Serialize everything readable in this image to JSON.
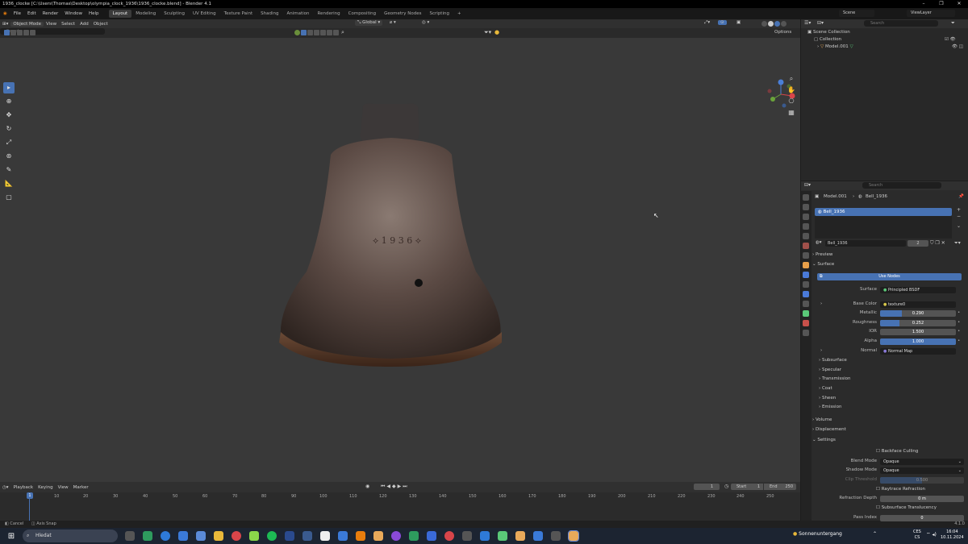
{
  "window": {
    "title": "1936_clocke [C:\\Users\\Thomas\\Desktop\\olympia_clock_1936\\1936_clocke.blend] - Blender 4.1"
  },
  "menu": [
    "File",
    "Edit",
    "Render",
    "Window",
    "Help"
  ],
  "workspaces": [
    "Layout",
    "Modeling",
    "Sculpting",
    "UV Editing",
    "Texture Paint",
    "Shading",
    "Animation",
    "Rendering",
    "Compositing",
    "Geometry Nodes",
    "Scripting"
  ],
  "topright": {
    "scene": "Scene",
    "viewlayer": "ViewLayer"
  },
  "viewport": {
    "mode": "Object Mode",
    "menus": [
      "View",
      "Select",
      "Add",
      "Object"
    ],
    "orientation": "Global",
    "search_placeholder": "Search",
    "options": "Options"
  },
  "outliner": {
    "scene_collection": "Scene Collection",
    "collection": "Collection",
    "object": "Model.001",
    "search_placeholder": "Search"
  },
  "properties": {
    "breadcrumb_object": "Model.001",
    "breadcrumb_material": "Bell_1936",
    "slot": "Bell_1936",
    "material_name": "Bell_1936",
    "user_count": "2",
    "preview": "Preview",
    "surface_section": "Surface",
    "use_nodes": "Use Nodes",
    "surface_label": "Surface",
    "surface_value": "Principled BSDF",
    "base_color_label": "Base Color",
    "base_color_value": "texture0",
    "metallic_label": "Metallic",
    "metallic": "0.290",
    "metallic_frac": 0.29,
    "roughness_label": "Roughness",
    "roughness": "0.252",
    "roughness_frac": 0.252,
    "ior_label": "IOR",
    "ior": "1.500",
    "alpha_label": "Alpha",
    "alpha": "1.000",
    "alpha_frac": 1.0,
    "normal_label": "Normal",
    "normal_value": "Normal Map",
    "subsections": [
      "Subsurface",
      "Specular",
      "Transmission",
      "Coat",
      "Sheen",
      "Emission"
    ],
    "volume": "Volume",
    "displacement": "Displacement",
    "settings": "Settings",
    "backface_culling": "Backface Culling",
    "blend_mode_label": "Blend Mode",
    "blend_mode": "Opaque",
    "shadow_mode_label": "Shadow Mode",
    "shadow_mode": "Opaque",
    "clip_threshold_label": "Clip Threshold",
    "clip_threshold": "0.500",
    "raytrace_refraction": "Raytrace Refraction",
    "refraction_depth_label": "Refraction Depth",
    "refraction_depth": "0 m",
    "subsurface_translucency": "Subsurface Translucency",
    "pass_index_label": "Pass Index",
    "pass_index": "0"
  },
  "timeline": {
    "menus": [
      "Playback",
      "Keying",
      "View",
      "Marker"
    ],
    "current_frame": "1",
    "start_label": "Start",
    "start": "1",
    "end_label": "End",
    "end": "250",
    "ticks": [
      "10",
      "20",
      "30",
      "40",
      "50",
      "60",
      "70",
      "80",
      "90",
      "100",
      "110",
      "120",
      "130",
      "140",
      "150",
      "160",
      "170",
      "180",
      "190",
      "200",
      "210",
      "220",
      "230",
      "240",
      "250"
    ],
    "cursor": "1"
  },
  "status": {
    "cancel": "Cancel",
    "axis_snap": "Axis Snap",
    "version": "4.1.0"
  },
  "taskbar": {
    "search": "Hledat",
    "weather": "Sonnenuntergang",
    "lang1": "CES",
    "lang2": "CS",
    "time": "16:04",
    "date": "10.11.2024"
  },
  "colors": {
    "accent": "#4772b3",
    "viewport_bg": "#393939"
  }
}
